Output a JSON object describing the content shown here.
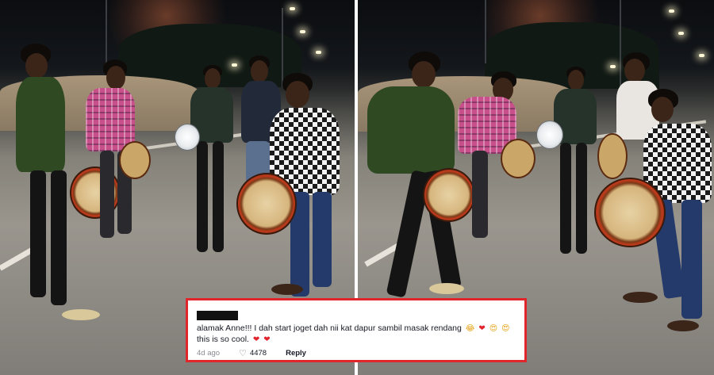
{
  "comment": {
    "line1_text": "alamak Anne!!! I dah start joget dah nii kat dapur sambil masak rendang",
    "line1_emojis": [
      {
        "glyph": "😂",
        "kind": "laugh-emoji"
      },
      {
        "glyph": "❤",
        "kind": "heart-emoji"
      },
      {
        "glyph": "😍",
        "kind": "heart-eyes-emoji"
      },
      {
        "glyph": "😍",
        "kind": "heart-eyes-emoji"
      }
    ],
    "line2_text": "this is so cool.",
    "line2_emojis": [
      {
        "glyph": "❤",
        "kind": "heart-emoji"
      },
      {
        "glyph": "❤",
        "kind": "heart-emoji"
      }
    ],
    "age": "4d ago",
    "like_icon": "heart-outline-icon",
    "likes": "4478",
    "reply_label": "Reply",
    "border_color": "#e0252b"
  }
}
